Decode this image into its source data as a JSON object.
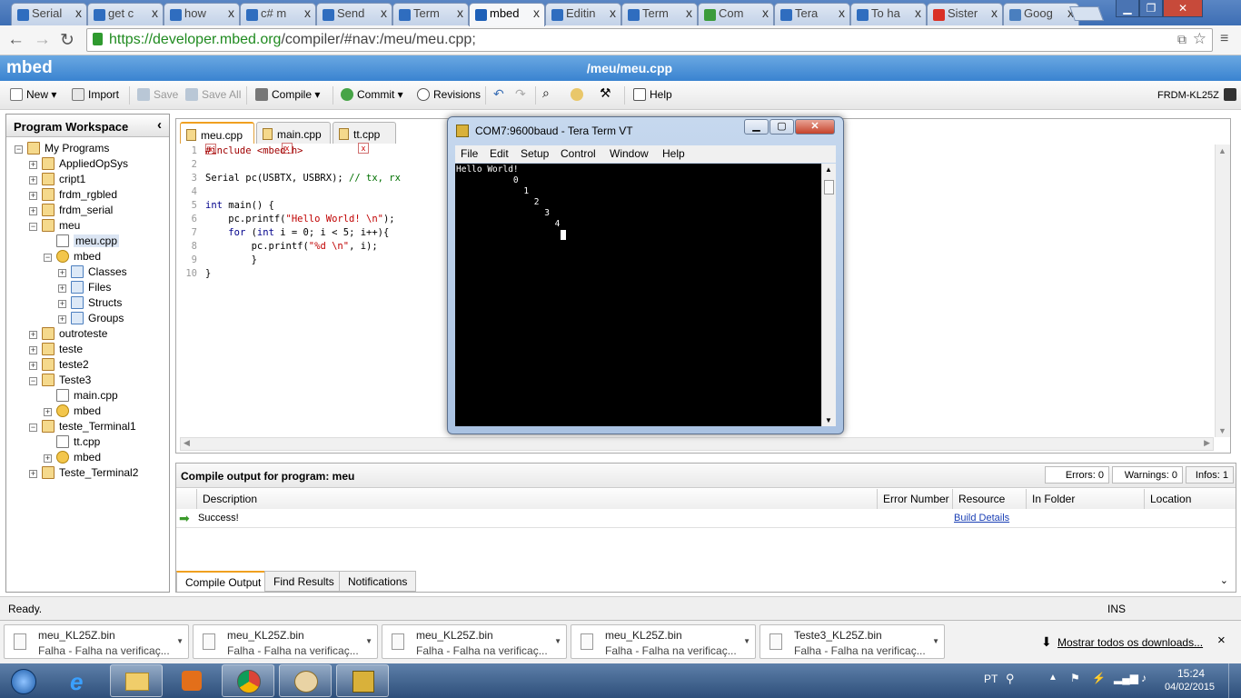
{
  "browser": {
    "tabs": [
      {
        "label": "Serial",
        "color": "#2f6dbf"
      },
      {
        "label": "get c",
        "color": "#2f6dbf"
      },
      {
        "label": "how",
        "color": "#2f6dbf"
      },
      {
        "label": "c# m",
        "color": "#2f6dbf"
      },
      {
        "label": "Send",
        "color": "#2f6dbf"
      },
      {
        "label": "Term",
        "color": "#2f6dbf"
      },
      {
        "label": "mbed",
        "color": "#1d5fb7"
      },
      {
        "label": "Editin",
        "color": "#2f6dbf"
      },
      {
        "label": "Term",
        "color": "#2f6dbf"
      },
      {
        "label": "Com",
        "color": "#3b9b3b"
      },
      {
        "label": "Tera",
        "color": "#2f6dbf"
      },
      {
        "label": "To ha",
        "color": "#2f6dbf"
      },
      {
        "label": "Sister",
        "color": "#d93025"
      },
      {
        "label": "Goog",
        "color": "#4a7fbf"
      }
    ],
    "tab_close": "x",
    "url_host": "https://developer.mbed.org",
    "url_path": "/compiler/#nav:/meu/meu.cpp;"
  },
  "mbed": {
    "logo": "mbed",
    "path_title": "/meu/meu.cpp",
    "platform": "FRDM-KL25Z"
  },
  "toolbar": {
    "new": "New",
    "import": "Import",
    "save": "Save",
    "save_all": "Save All",
    "compile": "Compile",
    "commit": "Commit",
    "revisions": "Revisions",
    "help": "Help"
  },
  "workspace": {
    "title": "Program Workspace",
    "collapse": "‹",
    "tree": [
      {
        "label": "My Programs",
        "depth": 0,
        "exp": "-",
        "icon": "folder"
      },
      {
        "label": "AppliedOpSys",
        "depth": 1,
        "exp": "+",
        "icon": "folder"
      },
      {
        "label": "cript1",
        "depth": 1,
        "exp": "+",
        "icon": "folder"
      },
      {
        "label": "frdm_rgbled",
        "depth": 1,
        "exp": "+",
        "icon": "folder"
      },
      {
        "label": "frdm_serial",
        "depth": 1,
        "exp": "+",
        "icon": "folder"
      },
      {
        "label": "meu",
        "depth": 1,
        "exp": "-",
        "icon": "folder"
      },
      {
        "label": "meu.cpp",
        "depth": 2,
        "exp": "",
        "icon": "file",
        "selected": true
      },
      {
        "label": "mbed",
        "depth": 2,
        "exp": "-",
        "icon": "gear"
      },
      {
        "label": "Classes",
        "depth": 3,
        "exp": "+",
        "icon": "cls"
      },
      {
        "label": "Files",
        "depth": 3,
        "exp": "+",
        "icon": "cls"
      },
      {
        "label": "Structs",
        "depth": 3,
        "exp": "+",
        "icon": "cls"
      },
      {
        "label": "Groups",
        "depth": 3,
        "exp": "+",
        "icon": "cls"
      },
      {
        "label": "outroteste",
        "depth": 1,
        "exp": "+",
        "icon": "folder"
      },
      {
        "label": "teste",
        "depth": 1,
        "exp": "+",
        "icon": "folder"
      },
      {
        "label": "teste2",
        "depth": 1,
        "exp": "+",
        "icon": "folder"
      },
      {
        "label": "Teste3",
        "depth": 1,
        "exp": "-",
        "icon": "folder"
      },
      {
        "label": "main.cpp",
        "depth": 2,
        "exp": "",
        "icon": "file"
      },
      {
        "label": "mbed",
        "depth": 2,
        "exp": "+",
        "icon": "gear"
      },
      {
        "label": "teste_Terminal1",
        "depth": 1,
        "exp": "-",
        "icon": "folder"
      },
      {
        "label": "tt.cpp",
        "depth": 2,
        "exp": "",
        "icon": "file"
      },
      {
        "label": "mbed",
        "depth": 2,
        "exp": "+",
        "icon": "gear"
      },
      {
        "label": "Teste_Terminal2",
        "depth": 1,
        "exp": "+",
        "icon": "folder"
      }
    ]
  },
  "editor": {
    "tabs": [
      {
        "label": "meu.cpp",
        "active": true
      },
      {
        "label": "main.cpp"
      },
      {
        "label": "tt.cpp"
      }
    ],
    "tab_close": "x",
    "line_numbers": [
      "1",
      "2",
      "3",
      "4",
      "5",
      "6",
      "7",
      "8",
      "9",
      "10"
    ]
  },
  "teraterm": {
    "title": "COM7:9600baud - Tera Term VT",
    "menu": [
      "File",
      "Edit",
      "Setup",
      "Control",
      "Window",
      "Help"
    ],
    "lines": [
      "Hello World!",
      "           0",
      "             1",
      "               2",
      "                 3",
      "                   4"
    ]
  },
  "compile": {
    "title": "Compile output for program: meu",
    "errors": "Errors: 0",
    "warnings": "Warnings: 0",
    "infos": "Infos: 1",
    "columns": [
      "Description",
      "Error Number",
      "Resource",
      "In Folder",
      "Location"
    ],
    "row_description": "Success!",
    "row_resource": "Build Details",
    "tabs": [
      "Compile Output",
      "Find Results",
      "Notifications"
    ]
  },
  "status": {
    "ready": "Ready.",
    "mode": "INS"
  },
  "downloads": {
    "items": [
      {
        "name": "meu_KL25Z.bin",
        "status": "Falha - Falha na verificaç..."
      },
      {
        "name": "meu_KL25Z.bin",
        "status": "Falha - Falha na verificaç..."
      },
      {
        "name": "meu_KL25Z.bin",
        "status": "Falha - Falha na verificaç..."
      },
      {
        "name": "meu_KL25Z.bin",
        "status": "Falha - Falha na verificaç..."
      },
      {
        "name": "Teste3_KL25Z.bin",
        "status": "Falha - Falha na verificaç..."
      }
    ],
    "show_all": "Mostrar todos os downloads...",
    "close": "×"
  },
  "taskbar": {
    "language": "PT",
    "time": "15:24",
    "date": "04/02/2015"
  }
}
